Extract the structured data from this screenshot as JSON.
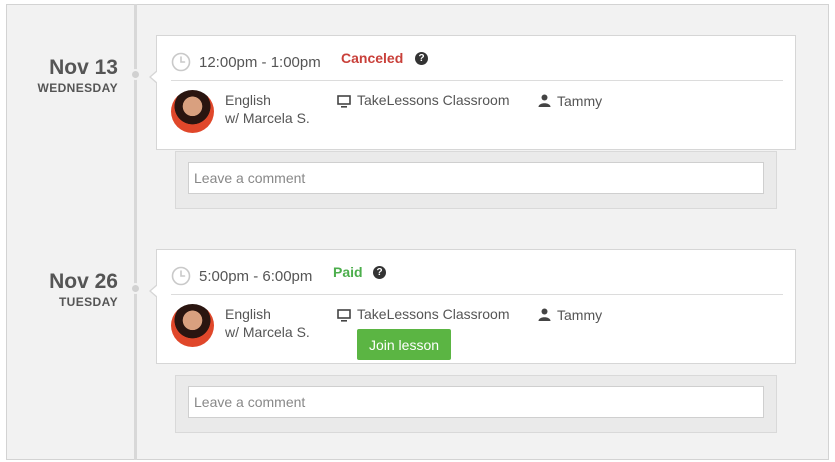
{
  "lessons": [
    {
      "date_day": "Nov 13",
      "date_weekday": "WEDNESDAY",
      "time": "12:00pm - 1:00pm",
      "status": "Canceled",
      "status_color": "#c9403a",
      "subject": "English",
      "teacher": "w/ Marcela S.",
      "location": "TakeLessons Classroom",
      "student": "Tammy",
      "comment_placeholder": "Leave a comment"
    },
    {
      "date_day": "Nov 26",
      "date_weekday": "TUESDAY",
      "time": "5:00pm - 6:00pm",
      "status": "Paid",
      "status_color": "#4cae4c",
      "subject": "English",
      "teacher": "w/ Marcela S.",
      "location": "TakeLessons Classroom",
      "student": "Tammy",
      "join_label": "Join lesson",
      "comment_placeholder": "Leave a comment"
    }
  ],
  "icons": {
    "clock": "clock-icon",
    "help": "question-circle-icon",
    "monitor": "monitor-icon",
    "user": "user-icon"
  },
  "help_glyph": "?"
}
